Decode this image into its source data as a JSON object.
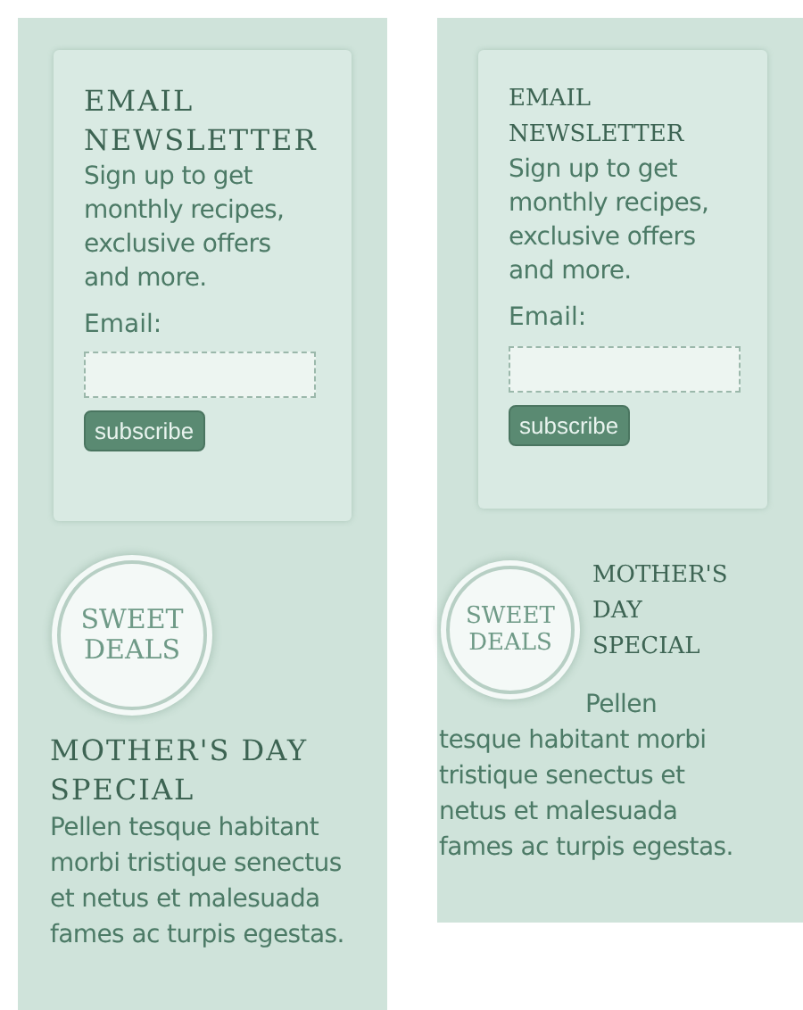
{
  "panels": [
    {
      "kind": "stacked",
      "newsletter": {
        "title": "EMAIL NEWSLETTER",
        "text": "Sign up to get monthly recipes, exclusive offers and more.",
        "label": "Email:",
        "button": "subscribe"
      },
      "promo": {
        "badge": "SWEET DEALS",
        "title": "MOTHER'S DAY SPECIAL",
        "text": "Pellen tesque habitant morbi tristique senectus et netus et malesuada fames ac turpis egestas."
      }
    },
    {
      "kind": "floated",
      "newsletter": {
        "title": "EMAIL NEWSLETTER",
        "text": "Sign up to get monthly recipes, exclusive offers and more.",
        "label": "Email:",
        "button": "subscribe"
      },
      "promo": {
        "badge": "SWEET DEALS",
        "title": "MOTHER'S DAY SPECIAL",
        "text": "Pellen tesque habitant morbi tristique senectus et netus et malesuada fames ac turpis egestas."
      }
    }
  ]
}
